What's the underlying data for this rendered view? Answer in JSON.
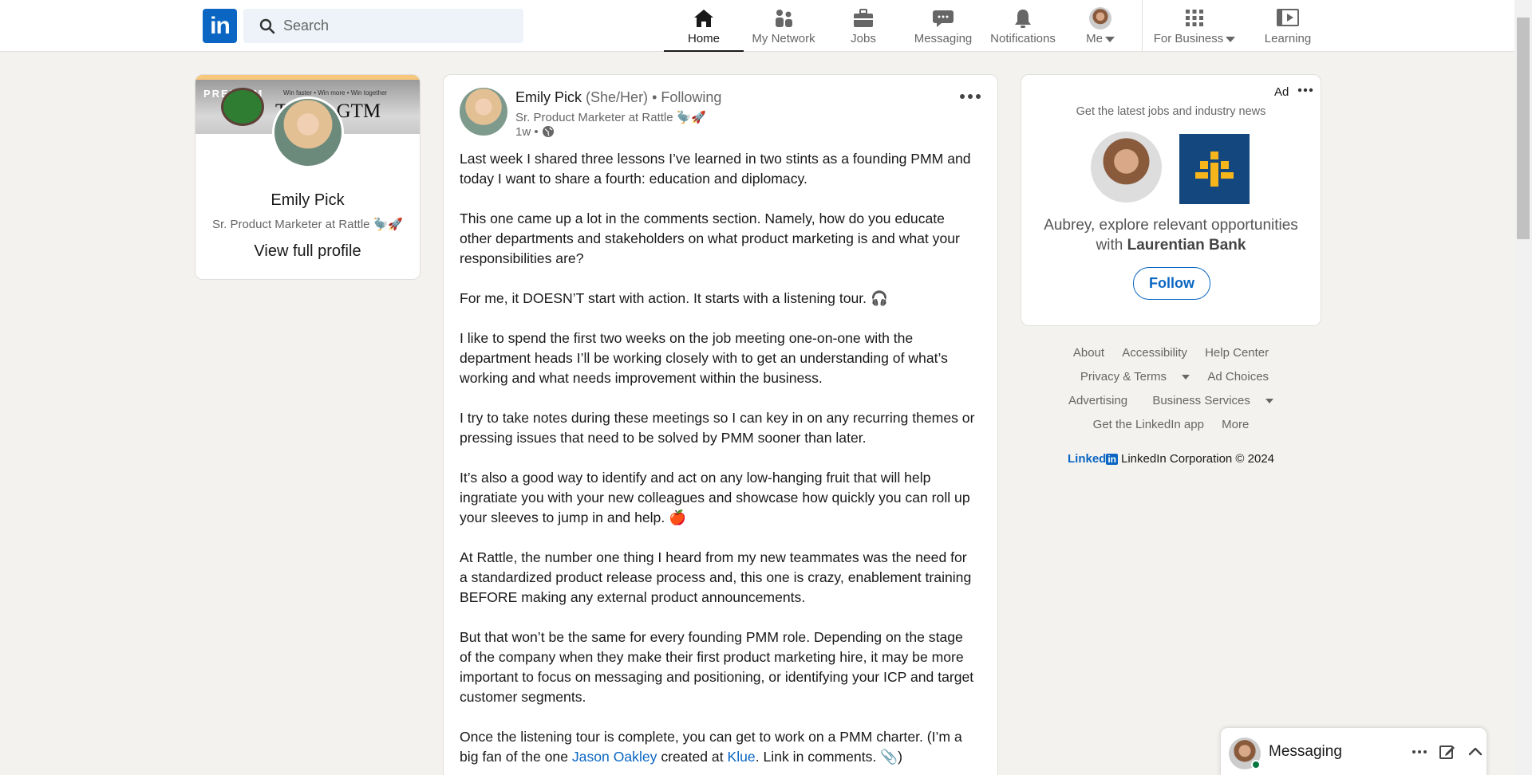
{
  "nav": {
    "logo": "in",
    "search_placeholder": "Search",
    "items": [
      {
        "label": "Home",
        "icon": "home-icon"
      },
      {
        "label": "My Network",
        "icon": "network-icon"
      },
      {
        "label": "Jobs",
        "icon": "briefcase-icon"
      },
      {
        "label": "Messaging",
        "icon": "messaging-icon"
      },
      {
        "label": "Notifications",
        "icon": "bell-icon"
      },
      {
        "label": "Me",
        "icon": "avatar"
      },
      {
        "label": "For Business",
        "icon": "grid-icon"
      },
      {
        "label": "Learning",
        "icon": "learning-icon"
      }
    ]
  },
  "profile": {
    "banner_premium": "PREMIUM",
    "banner_tagline": "Win faster • Win more • Win together",
    "banner_title": "T    S for GTM",
    "name": "Emily Pick",
    "headline": "Sr. Product Marketer at Rattle 🦤🚀",
    "view_profile": "View full profile"
  },
  "post": {
    "author": "Emily Pick",
    "pronouns": "(She/Her)",
    "separator": "•",
    "following": "Following",
    "headline": "Sr. Product Marketer at Rattle 🦤🚀",
    "time": "1w •",
    "paragraphs": [
      "Last week I shared three lessons I’ve learned in two stints as a founding PMM and today I want to share a fourth: education and diplomacy.",
      "This one came up a lot in the comments section. Namely, how do you educate other departments and stakeholders on what product marketing is and what your responsibilities are?",
      "For me, it DOESN’T start with action. It starts with a listening tour. 🎧",
      "I like to spend the first two weeks on the job meeting one-on-one with the department heads I’ll be working closely with to get an understanding of what’s working and what needs improvement within the business.",
      "I try to take notes during these meetings so I can key in on any recurring themes or pressing issues that need to be solved by PMM sooner than later.",
      "It’s also a good way to identify and act on any low-hanging fruit that will help ingratiate you with your new colleagues and showcase how quickly you can roll up your sleeves to jump in and help. 🍎",
      "At Rattle, the number one thing I heard from my new teammates was the need for a standardized product release process and, this one is crazy, enablement training BEFORE making any external product announcements.",
      "But that won’t be the same for every founding PMM role. Depending on the stage of the company when they make their first product marketing hire, it may be more important to focus on messaging and positioning, or identifying your ICP and target customer segments."
    ],
    "last_paragraph": {
      "before": "Once the listening tour is complete, you can get to work on a PMM charter. (I’m a big fan of the one ",
      "mention1": "Jason Oakley",
      "middle": " created at ",
      "mention2": "Klue",
      "after": ". Link in comments. 📎)"
    }
  },
  "ad": {
    "label": "Ad",
    "subtitle": "Get the latest jobs and industry news",
    "title_line1": "Aubrey, explore relevant opportunities",
    "title_with": "with",
    "company": "Laurentian Bank",
    "follow": "Follow"
  },
  "footer": {
    "row1": [
      "About",
      "Accessibility",
      "Help Center"
    ],
    "row2": [
      "Privacy & Terms",
      "Ad Choices"
    ],
    "row3": [
      "Advertising",
      "Business Services"
    ],
    "row4": [
      "Get the LinkedIn app",
      "More"
    ],
    "brand": "Linked",
    "brand_box": "in",
    "copyright": "LinkedIn Corporation © 2024"
  },
  "messaging": {
    "label": "Messaging"
  },
  "colors": {
    "brand": "#0a66c2",
    "page_bg": "#f4f2ee",
    "online": "#057642"
  }
}
